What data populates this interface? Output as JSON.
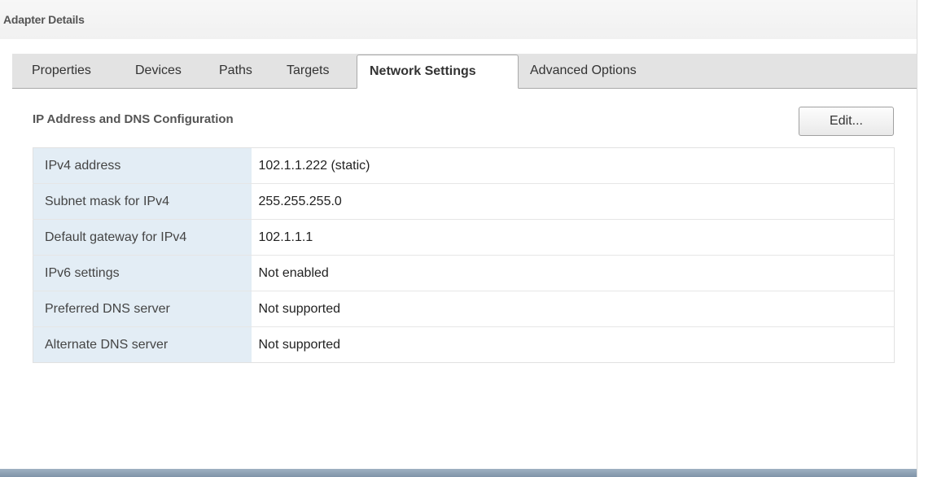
{
  "header": {
    "title": "Adapter Details"
  },
  "tabs": [
    {
      "label": "Properties",
      "active": false
    },
    {
      "label": "Devices",
      "active": false
    },
    {
      "label": "Paths",
      "active": false
    },
    {
      "label": "Targets",
      "active": false
    },
    {
      "label": "Network Settings",
      "active": true
    },
    {
      "label": "Advanced Options",
      "active": false
    }
  ],
  "section": {
    "title": "IP Address and DNS Configuration",
    "edit_label": "Edit..."
  },
  "properties": [
    {
      "key": "IPv4 address",
      "value": "102.1.1.222 (static)"
    },
    {
      "key": "Subnet mask for IPv4",
      "value": "255.255.255.0"
    },
    {
      "key": "Default gateway for IPv4",
      "value": "102.1.1.1"
    },
    {
      "key": "IPv6 settings",
      "value": "Not enabled"
    },
    {
      "key": "Preferred DNS server",
      "value": "Not supported"
    },
    {
      "key": "Alternate DNS server",
      "value": "Not supported"
    }
  ],
  "colors": {
    "key_column_bg": "#e3edf5",
    "tabbar_bg": "#e3e3e3",
    "bottom_bar": "#8aa0b5"
  }
}
